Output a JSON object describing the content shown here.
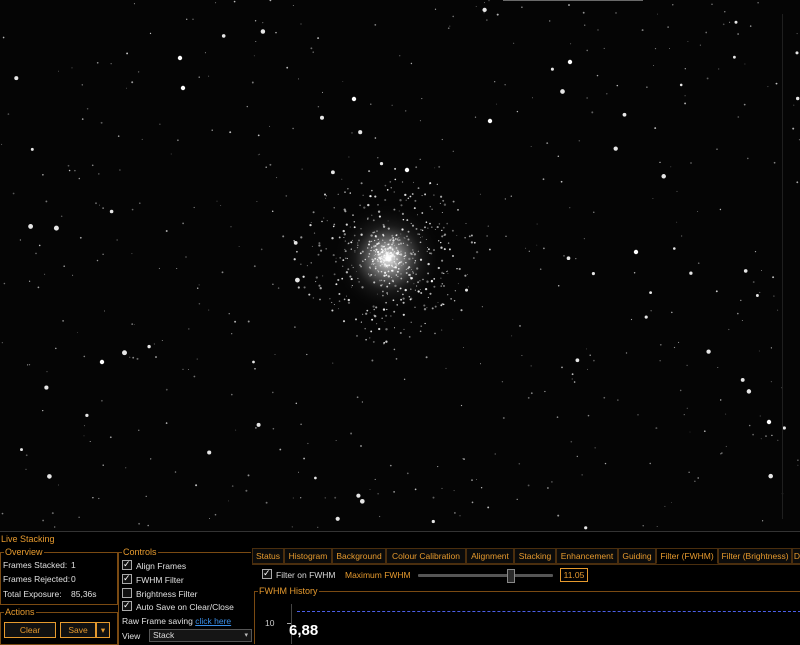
{
  "window": {
    "panel_title": "Live Stacking"
  },
  "overview": {
    "title": "Overview",
    "rows": [
      {
        "label": "Frames Stacked:",
        "value": "1"
      },
      {
        "label": "Frames Rejected:",
        "value": "0"
      },
      {
        "label": "Total Exposure:",
        "value": "85,36s"
      }
    ]
  },
  "actions": {
    "title": "Actions",
    "clear_label": "Clear",
    "save_label": "Save",
    "dropdown_glyph": "▾"
  },
  "controls": {
    "title": "Controls",
    "checkboxes": [
      {
        "label": "Align Frames",
        "checked": true
      },
      {
        "label": "FWHM Filter",
        "checked": true
      },
      {
        "label": "Brightness Filter",
        "checked": false
      },
      {
        "label": "Auto Save on Clear/Close",
        "checked": true
      }
    ],
    "raw_label": "Raw Frame saving",
    "raw_link": "click here",
    "view_label": "View",
    "view_value": "Stack",
    "view_arrow": "▾"
  },
  "tabs": [
    {
      "label": "Status"
    },
    {
      "label": "Histogram"
    },
    {
      "label": "Background"
    },
    {
      "label": "Colour Calibration"
    },
    {
      "label": "Alignment"
    },
    {
      "label": "Stacking"
    },
    {
      "label": "Enhancement"
    },
    {
      "label": "Guiding"
    },
    {
      "label": "Filter (FWHM)",
      "active": true
    },
    {
      "label": "Filter (Brightness)"
    },
    {
      "label": "D"
    }
  ],
  "fwhm_filter": {
    "checkbox_label": "Filter on FWHM",
    "checked": true,
    "max_label": "Maximum FWHM",
    "max_value": "11.05",
    "slider_fraction": 0.68
  },
  "history": {
    "title": "FWHM History",
    "y_tick": "10",
    "current_value": "6,88",
    "threshold_color": "#4b5fe8"
  },
  "colors": {
    "accent": "#e69a2e",
    "link": "#3a8fe8"
  }
}
